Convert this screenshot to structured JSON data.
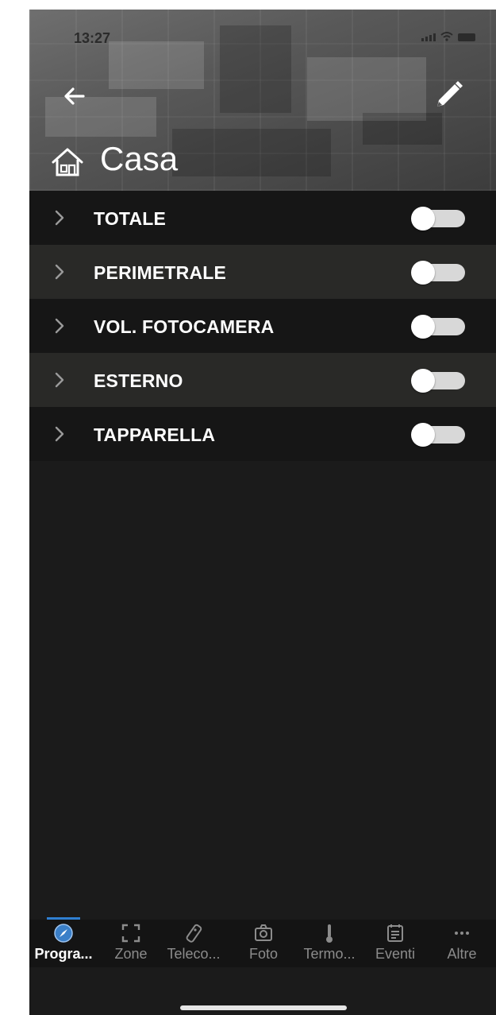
{
  "status": {
    "time": "13:27"
  },
  "header": {
    "title": "Casa"
  },
  "programs": [
    {
      "label": "TOTALE",
      "on": false
    },
    {
      "label": "PERIMETRALE",
      "on": false
    },
    {
      "label": "VOL. FOTOCAMERA",
      "on": false
    },
    {
      "label": "ESTERNO",
      "on": false
    },
    {
      "label": "TAPPARELLA",
      "on": false
    }
  ],
  "tabs": [
    {
      "label": "Progra...",
      "icon": "compass-icon",
      "active": true
    },
    {
      "label": "Zone",
      "icon": "zone-frame-icon",
      "active": false
    },
    {
      "label": "Teleco...",
      "icon": "remote-control-icon",
      "active": false
    },
    {
      "label": "Foto",
      "icon": "camera-icon",
      "active": false
    },
    {
      "label": "Termo...",
      "icon": "thermometer-icon",
      "active": false
    },
    {
      "label": "Eventi",
      "icon": "events-list-icon",
      "active": false
    },
    {
      "label": "Altre",
      "icon": "more-dots-icon",
      "active": false
    }
  ],
  "colors": {
    "accent": "#2f7fd1",
    "background": "#1b1b1b",
    "toggle_off": "#d8d8d8"
  }
}
